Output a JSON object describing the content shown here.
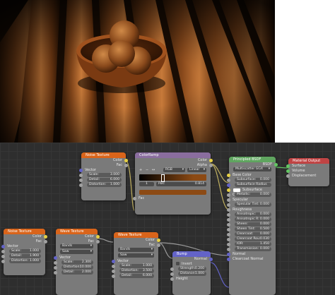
{
  "render": {
    "description_icon": "wooden-bowl-render"
  },
  "nodes": {
    "noise1": {
      "title": "Noise Texture",
      "out": [
        "Color",
        "Fac"
      ],
      "in_vector": "Vector",
      "fields": [
        {
          "label": "Scale:",
          "value": "3.000"
        },
        {
          "label": "Detail:",
          "value": "6.000"
        },
        {
          "label": "Distortion:",
          "value": "1.000"
        }
      ]
    },
    "colorramp": {
      "title": "ColorRamp",
      "out": [
        "Color",
        "Alpha"
      ],
      "mode1": "RGB",
      "mode2": "Linear",
      "btns": [
        "+",
        "−",
        "↔"
      ],
      "stop": "1",
      "pos_label": "Pos:",
      "pos_value": "0.814",
      "in_fac": "Fac",
      "stop_color": "#8c4a14"
    },
    "principled": {
      "title": "Principled BSDF",
      "out": "BSDF",
      "dist": "Multiscatter GGX",
      "sss": "Subsurface Radius",
      "fields": [
        {
          "label": "Base Color"
        },
        {
          "label": "Subsurface:",
          "value": "0.000"
        },
        {
          "label": "Subsurface Radius"
        },
        {
          "label": "Subsurface Color"
        },
        {
          "label": "Metallic:",
          "value": "0.000"
        },
        {
          "label": "Specular"
        },
        {
          "label": "Specular Tint:",
          "value": "0.000"
        },
        {
          "label": "Roughness"
        },
        {
          "label": "Anisotropic:",
          "value": "0.000"
        },
        {
          "label": "Anisotropic R:",
          "value": "0.000"
        },
        {
          "label": "Sheen:",
          "value": "0.000"
        },
        {
          "label": "Sheen Tint:",
          "value": "0.500"
        },
        {
          "label": "Clearcoat:",
          "value": "0.000"
        },
        {
          "label": "Clearcoat Rou:",
          "value": "0.030"
        },
        {
          "label": "IOR:",
          "value": "1.450"
        },
        {
          "label": "Transmission:",
          "value": "0.000"
        },
        {
          "label": "Normal"
        },
        {
          "label": "Clearcoat Normal"
        }
      ]
    },
    "output": {
      "title": "Material Output",
      "in": [
        "Surface",
        "Volume",
        "Displacement"
      ]
    },
    "noise2": {
      "title": "Noise Texture",
      "out": [
        "Color",
        "Fac"
      ],
      "in_vector": "Vector",
      "fields": [
        {
          "label": "Scale:",
          "value": "1.000"
        },
        {
          "label": "Detail:",
          "value": "1.900"
        },
        {
          "label": "Distortion:",
          "value": "1.000"
        }
      ]
    },
    "wave1": {
      "title": "Wave Texture",
      "out": [
        "Color",
        "Fac"
      ],
      "opt1": "Bands",
      "opt2": "Saw",
      "in_vector": "Vector",
      "fields": [
        {
          "label": "Scale:",
          "value": "2.300"
        },
        {
          "label": "Distortion:",
          "value": "10.000"
        },
        {
          "label": "Detail:",
          "value": "2.000"
        }
      ]
    },
    "wave2": {
      "title": "Wave Texture",
      "out": [
        "Color",
        "Fac"
      ],
      "opt1": "Bands",
      "opt2": "Saw",
      "in_vector": "Vector",
      "fields": [
        {
          "label": "Scale:",
          "value": "1.000"
        },
        {
          "label": "Distortion:",
          "value": "3.500"
        },
        {
          "label": "Detail:",
          "value": "6.000"
        }
      ]
    },
    "bump": {
      "title": "Bump",
      "out": "Normal",
      "invert": "Invert",
      "fields": [
        {
          "label": "Strength:",
          "value": "0.200"
        },
        {
          "label": "Distance:",
          "value": "1.000"
        }
      ],
      "in_height": "Height"
    }
  }
}
